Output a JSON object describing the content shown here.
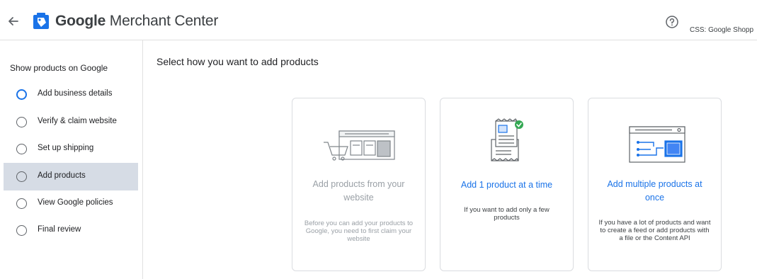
{
  "header": {
    "brand_google": "Google",
    "brand_product": "Merchant Center",
    "account": "CSS: Google Shopp",
    "icons": {
      "back": "arrow-left-icon",
      "logo": "merchant-center-logo",
      "help": "help-circle-icon"
    }
  },
  "sidebar": {
    "title": "Show products on Google",
    "steps": [
      {
        "label": "Add business details"
      },
      {
        "label": "Verify & claim website"
      },
      {
        "label": "Set up shipping"
      },
      {
        "label": "Add products"
      },
      {
        "label": "View Google policies"
      },
      {
        "label": "Final review"
      }
    ]
  },
  "main": {
    "title": "Select how you want to add products",
    "cards": [
      {
        "title": "Add products from your website",
        "description": "Before you can add your products to Google, you need to first claim your website"
      },
      {
        "title": "Add 1 product at a time",
        "description": "If you want to add only a few products"
      },
      {
        "title": "Add multiple products at once",
        "description": "If you have a lot of products and want to create a feed or add products with a file or the Content API"
      }
    ]
  },
  "colors": {
    "accent": "#1a73e8",
    "active_step_bg": "#d6dce5",
    "disabled_text": "#9aa0a6",
    "check_green": "#34a853"
  }
}
